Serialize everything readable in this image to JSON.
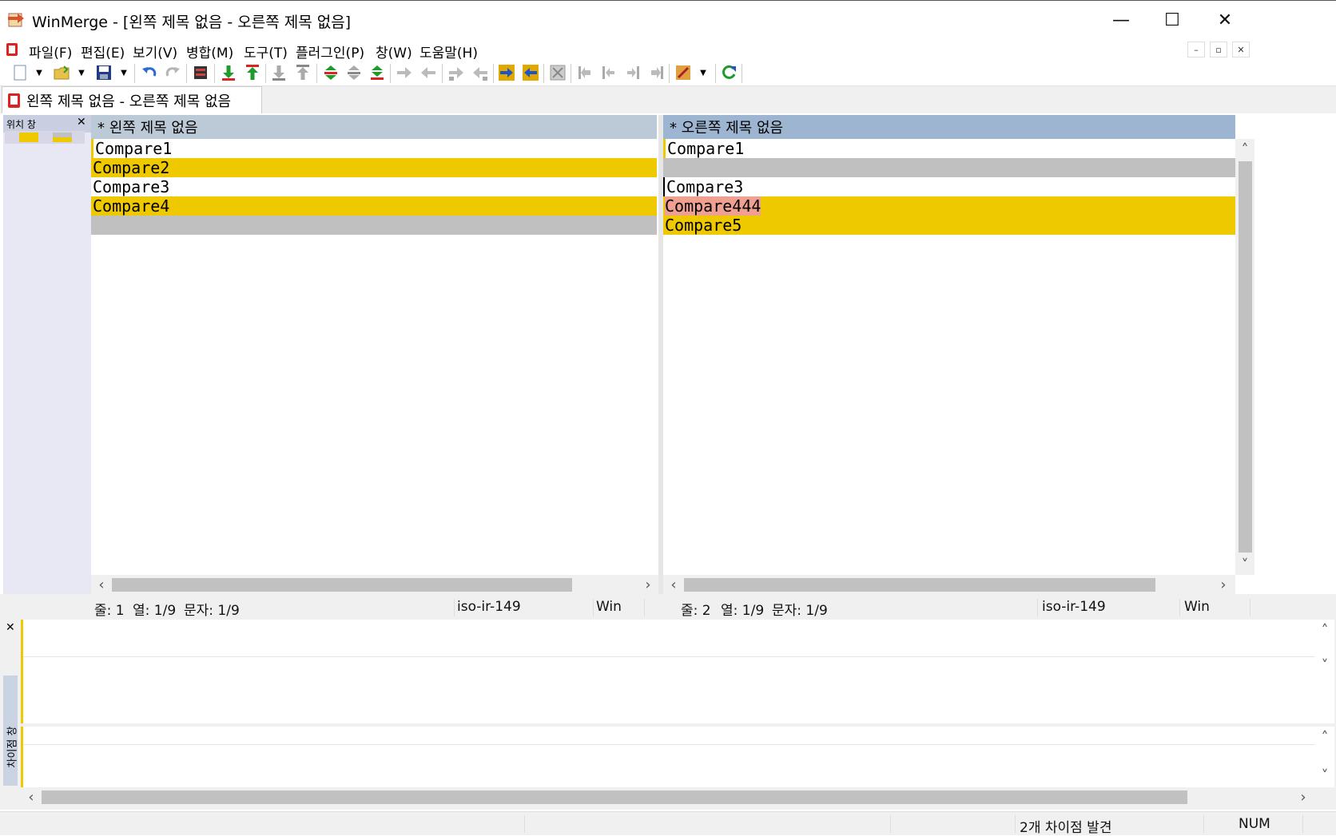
{
  "window": {
    "title": "WinMerge - [왼쪽 제목 없음 - 오른쪽 제목 없음]",
    "minimize": "—",
    "maximize": "☐",
    "close": "✕"
  },
  "menu": [
    "파일(F)",
    "편집(E)",
    "보기(V)",
    "병합(M)",
    "도구(T)",
    "플러그인(P)",
    "창(W)",
    "도움말(H)"
  ],
  "mdi_controls": {
    "minimize": "–",
    "restore": "▫",
    "close": "✕"
  },
  "tab": {
    "label": "왼쪽 제목 없음 - 오른쪽 제목 없음"
  },
  "location_pane": {
    "title": "위치 창",
    "close": "✕"
  },
  "left_pane": {
    "header": "* 왼쪽 제목 없음",
    "lines": [
      {
        "text": "Compare1",
        "state": "normal"
      },
      {
        "text": "Compare2",
        "state": "diff"
      },
      {
        "text": "Compare3",
        "state": "normal"
      },
      {
        "text": "Compare4",
        "state": "diff"
      },
      {
        "text": "",
        "state": "gap"
      }
    ],
    "status": {
      "line": "줄: 1",
      "col": "열: 1/9",
      "char": "문자: 1/9",
      "encoding": "iso-ir-149",
      "eol": "Win"
    }
  },
  "right_pane": {
    "header": "* 오른쪽 제목 없음",
    "lines": [
      {
        "text": "Compare1",
        "state": "normal"
      },
      {
        "text": "",
        "state": "gap"
      },
      {
        "text": "Compare3",
        "state": "normal"
      },
      {
        "text": "Compare444",
        "state": "diff-word"
      },
      {
        "text": "Compare5",
        "state": "diff"
      }
    ],
    "status": {
      "line": "줄: 2",
      "col": "열: 1/9",
      "char": "문자: 1/9",
      "encoding": "iso-ir-149",
      "eol": "Win"
    }
  },
  "diff_pane": {
    "title": "차이점 창",
    "close": "✕"
  },
  "statusbar": {
    "diff_count": "2개 차이점 발견",
    "num": "NUM"
  },
  "colors": {
    "diff": "#efc900",
    "gap": "#c0c0c0",
    "word_diff": "#f0a090",
    "left_header": "#bccad8",
    "right_header": "#9db5d0"
  }
}
